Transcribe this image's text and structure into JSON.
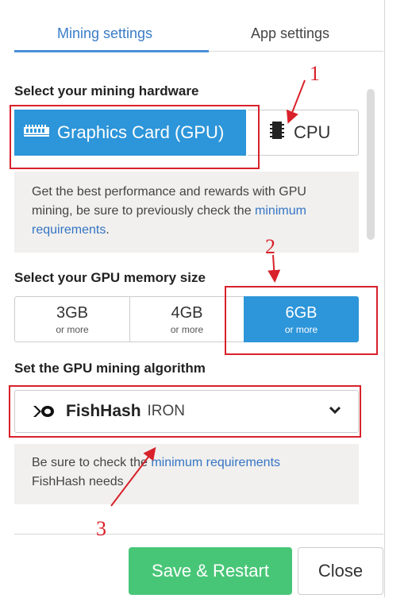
{
  "tabs": [
    {
      "label": "Mining settings",
      "active": true
    },
    {
      "label": "App settings",
      "active": false
    }
  ],
  "hardware": {
    "label": "Select your mining hardware",
    "gpu_label": "Graphics Card (GPU)",
    "cpu_label": "CPU",
    "selected": "gpu",
    "info_text": "Get the best performance and rewards with GPU mining, be sure to previously check the ",
    "info_link": "minimum requirements",
    "info_suffix": "."
  },
  "memory": {
    "label": "Select your GPU memory size",
    "options": [
      {
        "value": "3GB",
        "sub": "or more",
        "selected": false
      },
      {
        "value": "4GB",
        "sub": "or more",
        "selected": false
      },
      {
        "value": "6GB",
        "sub": "or more",
        "selected": true
      }
    ]
  },
  "algorithm": {
    "label": "Set the GPU mining algorithm",
    "name": "FishHash",
    "coin": "IRON",
    "info_prefix": "Be sure to check the ",
    "info_link": "minimum requirements",
    "info_suffix": "FishHash needs"
  },
  "footer": {
    "save_label": "Save & Restart",
    "close_label": "Close"
  },
  "annotations": [
    "1",
    "2",
    "3"
  ],
  "colors": {
    "accent_blue": "#2d95d9",
    "save_green": "#48c677",
    "annotation_red": "#d9212b",
    "link_blue": "#3574c4"
  }
}
